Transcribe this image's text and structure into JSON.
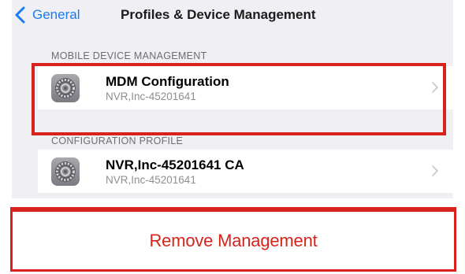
{
  "nav": {
    "back_label": "General",
    "title": "Profiles & Device Management"
  },
  "sections": [
    {
      "header": "MOBILE DEVICE MANAGEMENT",
      "item": {
        "icon": "gear-icon",
        "title": "MDM Configuration",
        "subtitle": "NVR,Inc-45201641",
        "highlighted": true
      }
    },
    {
      "header": "CONFIGURATION PROFILE",
      "item": {
        "icon": "gear-icon",
        "title": "NVR,Inc-45201641 CA",
        "subtitle": "NVR,Inc-45201641",
        "highlighted": false
      }
    }
  ],
  "action": {
    "remove_label": "Remove Management"
  },
  "colors": {
    "accent": "#1a7cf5",
    "highlight": "#d7231b",
    "background": "#efeff4"
  }
}
